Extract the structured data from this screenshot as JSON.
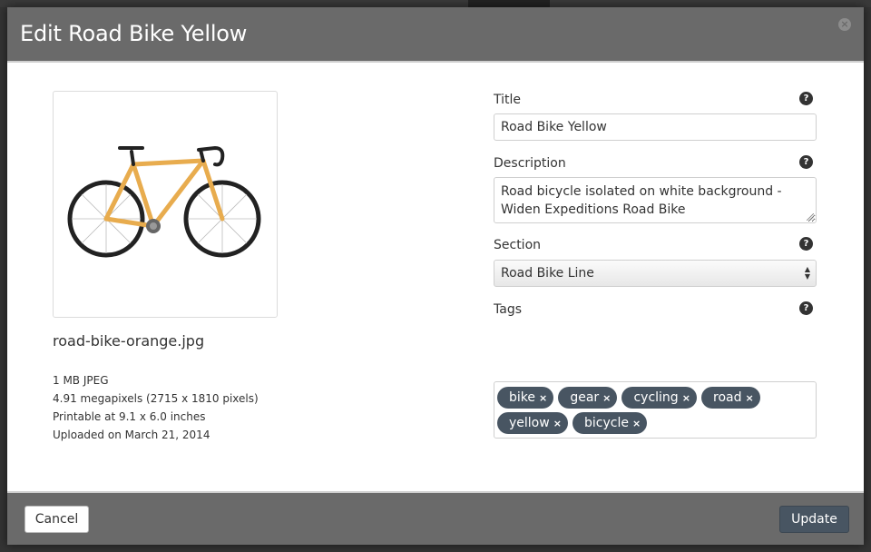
{
  "modal": {
    "title": "Edit Road Bike Yellow",
    "close_glyph": "×"
  },
  "asset": {
    "filename": "road-bike-orange.jpg",
    "size_type": "1 MB JPEG",
    "megapixels": "4.91 megapixels (2715 x 1810 pixels)",
    "printable": "Printable at 9.1 x 6.0 inches",
    "uploaded": "Uploaded on March 21, 2014"
  },
  "form": {
    "title_label": "Title",
    "title_value": "Road Bike Yellow",
    "description_label": "Description",
    "description_value": "Road bicycle isolated on white background - Widen Expeditions Road Bike",
    "section_label": "Section",
    "section_value": "Road Bike Line",
    "tags_label": "Tags",
    "help_glyph": "?",
    "tags": [
      "bike",
      "gear",
      "cycling",
      "road",
      "yellow",
      "bicycle"
    ],
    "tag_remove_glyph": "×"
  },
  "footer": {
    "cancel_label": "Cancel",
    "update_label": "Update"
  },
  "colors": {
    "header_bg": "#6a6a6a",
    "tag_bg": "#485562",
    "update_bg": "#485562",
    "bike_frame": "#e8ac4e"
  },
  "icons": {
    "help": "question-circle-icon",
    "close": "close-circle-icon",
    "tag_remove": "x-icon",
    "select_arrows": "up-down-arrows-icon"
  }
}
